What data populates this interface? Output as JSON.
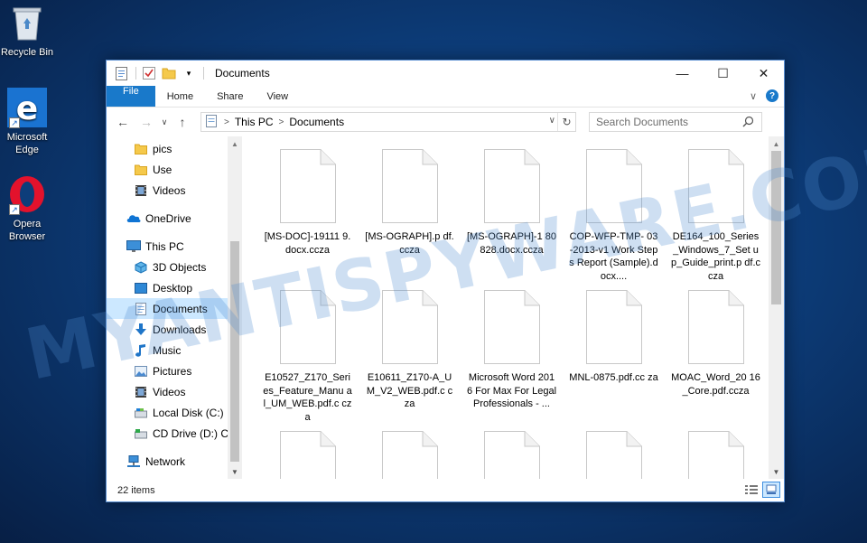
{
  "desktop": {
    "icons": [
      {
        "label": "Recycle Bin"
      },
      {
        "label": "Microsoft Edge"
      },
      {
        "label": "Opera Browser"
      }
    ],
    "watermark": "MYANTISPYWARE.COM"
  },
  "window": {
    "title": "Documents",
    "controls": {
      "minimize": "—",
      "maximize": "☐",
      "close": "✕"
    }
  },
  "ribbon": {
    "tabs": [
      "File",
      "Home",
      "Share",
      "View"
    ],
    "expand": "∨",
    "help": "?"
  },
  "address": {
    "crumbs": [
      "This PC",
      "Documents"
    ],
    "search_placeholder": "Search Documents"
  },
  "navpane": {
    "items": [
      {
        "label": "pics",
        "icon": "folder-icon"
      },
      {
        "label": "Use",
        "icon": "folder-icon"
      },
      {
        "label": "Videos",
        "icon": "videos-icon"
      },
      {
        "label": "OneDrive",
        "icon": "onedrive-icon"
      },
      {
        "label": "This PC",
        "icon": "computer-icon"
      },
      {
        "label": "3D Objects",
        "icon": "3d-objects-icon"
      },
      {
        "label": "Desktop",
        "icon": "desktop-icon"
      },
      {
        "label": "Documents",
        "icon": "documents-icon"
      },
      {
        "label": "Downloads",
        "icon": "downloads-icon"
      },
      {
        "label": "Music",
        "icon": "music-icon"
      },
      {
        "label": "Pictures",
        "icon": "pictures-icon"
      },
      {
        "label": "Videos",
        "icon": "videos-icon"
      },
      {
        "label": "Local Disk (C:)",
        "icon": "disk-icon"
      },
      {
        "label": "CD Drive (D:) CC",
        "icon": "cd-drive-icon"
      },
      {
        "label": "Network",
        "icon": "network-icon"
      }
    ]
  },
  "files": [
    "[MS-DOC]-19111 9.docx.ccza",
    "[MS-OGRAPH].p df.ccza",
    "[MS-OGRAPH]-1 80828.docx.ccza",
    "COP-WFP-TMP- 03-2013-v1 Work Steps Report (Sample).docx....",
    "DE164_100_Series _Windows_7_Set up_Guide_print.p df.ccza",
    "E10527_Z170_Seri es_Feature_Manu al_UM_WEB.pdf.c cza",
    "E10611_Z170-A_U M_V2_WEB.pdf.c cza",
    "Microsoft Word 2016 For Max For Legal Professionals - ...",
    "MNL-0875.pdf.cc za",
    "MOAC_Word_20 16_Core.pdf.ccza",
    "",
    "",
    "",
    "",
    ""
  ],
  "status": {
    "count": "22 items"
  }
}
